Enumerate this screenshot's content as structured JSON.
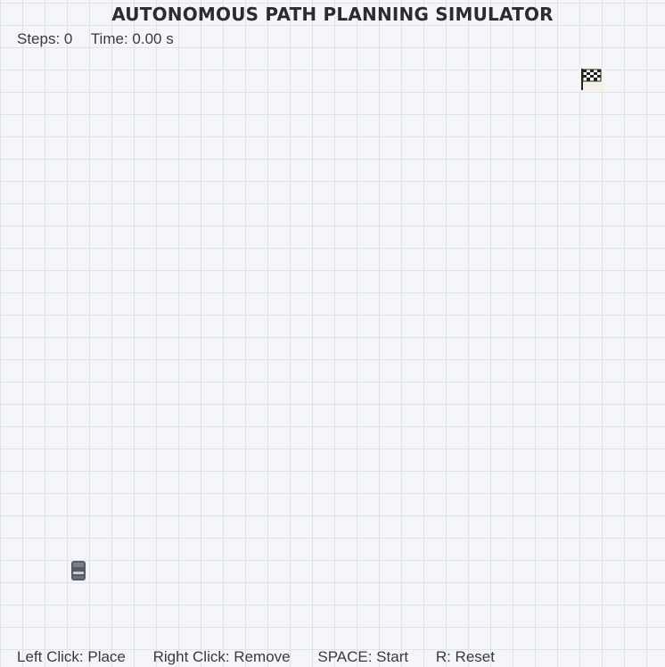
{
  "title": "AUTONOMOUS PATH PLANNING SIMULATOR",
  "stats": {
    "steps": "Steps: 0",
    "time": "Time: 0.00 s"
  },
  "grid": {
    "line_color": "#dfe2ea",
    "background_color": "#f5f6fa"
  },
  "goal": {
    "icon": "checkered-flag-icon"
  },
  "agent": {
    "icon": "robot-icon",
    "color": "#555a63"
  },
  "controls": [
    "Left Click: Place",
    "Right Click: Remove",
    "SPACE: Start",
    "R: Reset"
  ]
}
